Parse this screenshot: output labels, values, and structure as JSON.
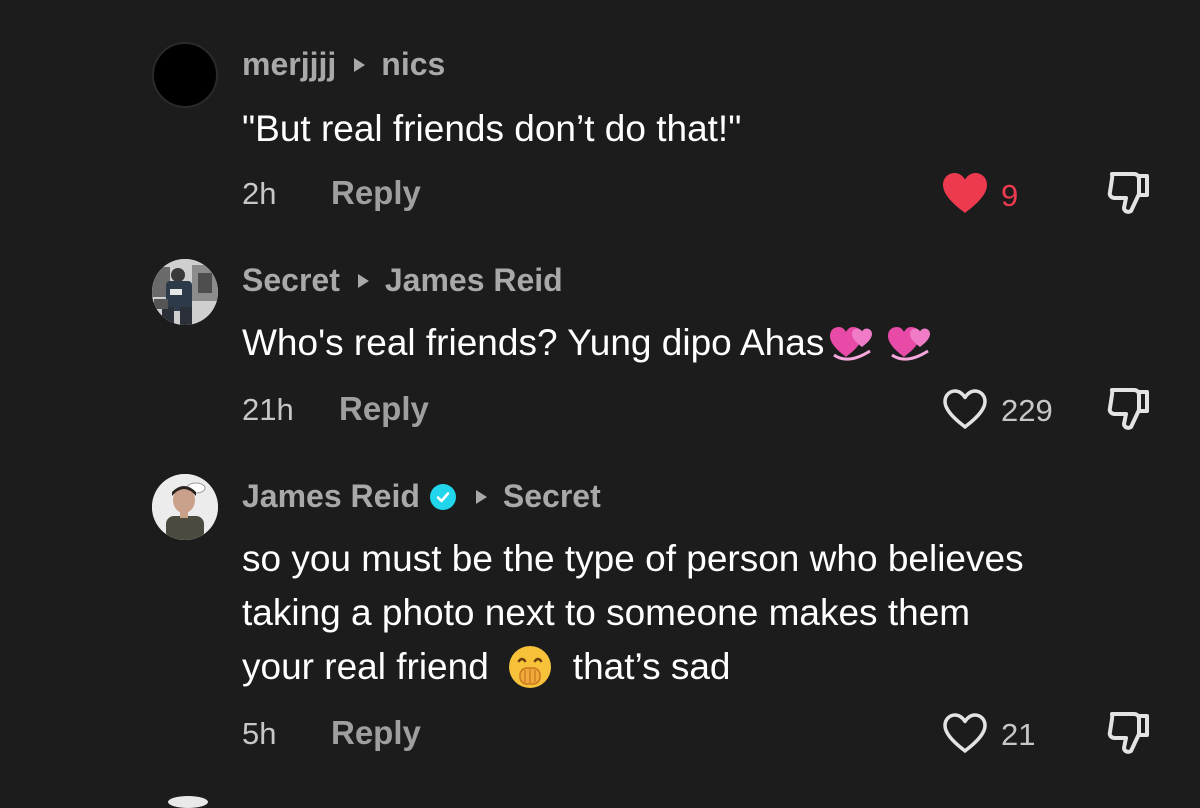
{
  "comments": [
    {
      "author": "merjjjj",
      "target": "nics",
      "text": "\"But real friends don’t do that!\"",
      "time": "2h",
      "reply_label": "Reply",
      "likes": "9",
      "liked": true
    },
    {
      "author": "Secret",
      "target": "James Reid",
      "text": "Who's real friends? Yung dipo Ahas",
      "time": "21h",
      "reply_label": "Reply",
      "likes": "229",
      "liked": false
    },
    {
      "author": "James Reid",
      "verified": true,
      "target": "Secret",
      "text_line1": "so you must be the type of person who believes",
      "text_line2": "taking a photo next to someone makes them",
      "text_line3a": "your real friend",
      "text_line3b": "that’s sad",
      "time": "5h",
      "reply_label": "Reply",
      "likes": "21",
      "liked": false
    }
  ],
  "colors": {
    "background": "#1c1c1c",
    "liked_heart": "#ee3a4f",
    "username": "#a9a9a9",
    "verified": "#20d5ec"
  },
  "icons": {
    "like": "heart-icon",
    "dislike": "thumbs-down-icon",
    "reply_arrow": "caret-right-icon"
  }
}
